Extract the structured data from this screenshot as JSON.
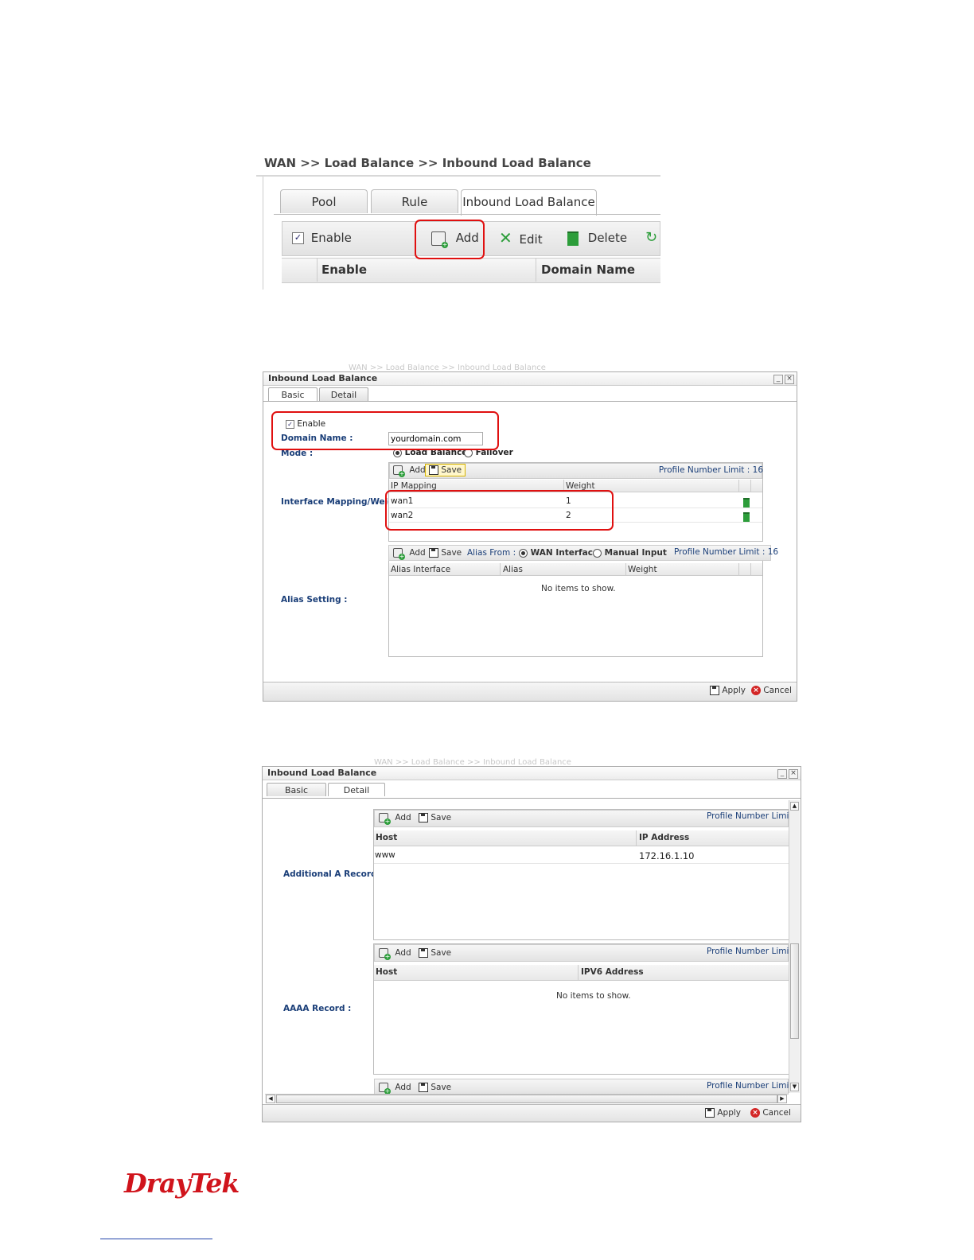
{
  "shot1": {
    "title": "WAN >> Load Balance >> Inbound Load Balance",
    "tabs": [
      "Pool",
      "Rule",
      "Inbound Load Balance"
    ],
    "toolbar": {
      "enable": "Enable",
      "add": "Add",
      "edit": "Edit",
      "delete": "Delete"
    },
    "columns": [
      "Enable",
      "Domain Name"
    ]
  },
  "dialog_basic": {
    "background_breadcrumb": "WAN >> Load Balance >> Inbound Load Balance",
    "title": "Inbound Load Balance",
    "tabs": [
      "Basic",
      "Detail"
    ],
    "enable_label": "Enable",
    "domain_label": "Domain Name :",
    "domain_value": "yourdomain.com",
    "mode_label": "Mode :",
    "mode_options": [
      "Load Balance",
      "Failover"
    ],
    "mapping_label": "Interface Mapping/Weight :",
    "add": "Add",
    "save": "Save",
    "profile_limit": "Profile Number Limit : 16",
    "mapping_columns": [
      "IP Mapping",
      "Weight"
    ],
    "mapping_rows": [
      {
        "ip": "wan1",
        "weight": "1"
      },
      {
        "ip": "wan2",
        "weight": "2"
      }
    ],
    "alias_label": "Alias Setting :",
    "alias_from": "Alias From :",
    "alias_options": [
      "WAN Interface",
      "Manual Input"
    ],
    "alias_columns": [
      "Alias Interface",
      "Alias",
      "Weight"
    ],
    "empty_text": "No items to show.",
    "apply": "Apply",
    "cancel": "Cancel"
  },
  "dialog_detail": {
    "background_breadcrumb": "WAN >> Load Balance >> Inbound Load Balance",
    "title": "Inbound Load Balance",
    "tabs": [
      "Basic",
      "Detail"
    ],
    "a_label": "Additional A Record :",
    "aaaa_label": "AAAA Record :",
    "add": "Add",
    "save": "Save",
    "profile_limit": "Profile Number Limi",
    "a_columns": [
      "Host",
      "IP Address"
    ],
    "a_rows": [
      {
        "host": "www",
        "ip": "172.16.1.10"
      }
    ],
    "aaaa_columns": [
      "Host",
      "IPV6 Address"
    ],
    "empty_text": "No items to show.",
    "apply": "Apply",
    "cancel": "Cancel"
  },
  "brand": {
    "logo": "DrayTek",
    "color": "#d0141c"
  }
}
